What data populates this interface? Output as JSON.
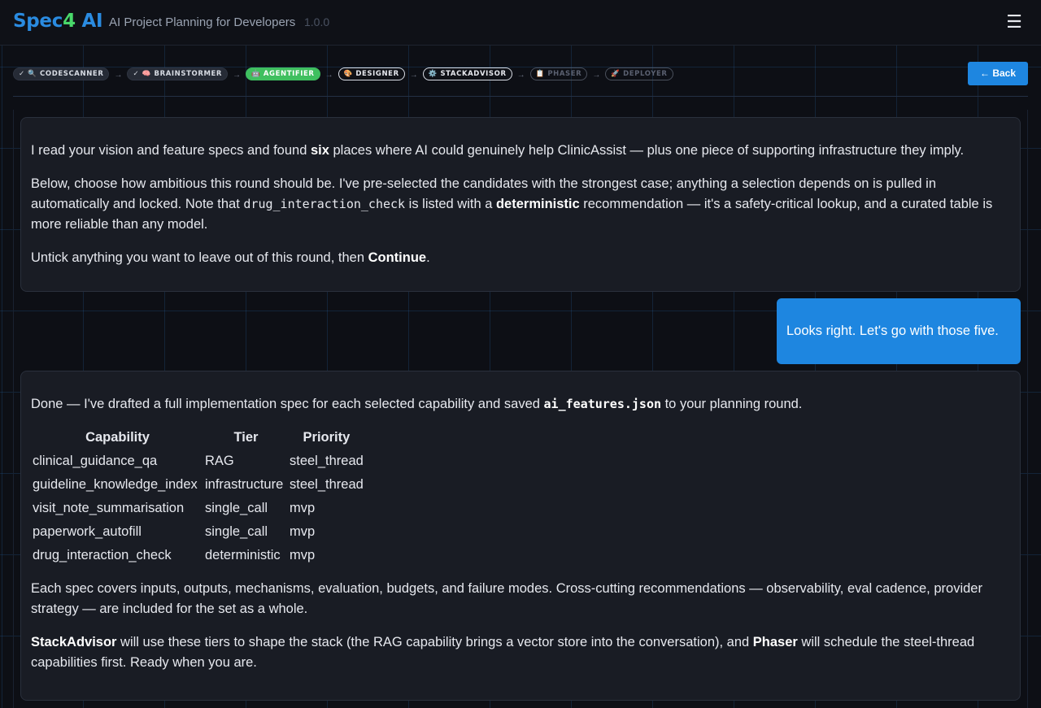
{
  "header": {
    "logo_prefix": "Spec",
    "logo_number": "4",
    "logo_suffix": " AI",
    "tagline": "AI Project Planning for Developers",
    "version": "1.0.0",
    "menu_icon": "☰"
  },
  "pipeline": {
    "steps": [
      {
        "label": "✓ 🔍 CODESCANNER",
        "state": "done"
      },
      {
        "label": "✓ 🧠 BRAINSTORMER",
        "state": "done"
      },
      {
        "label": "🤖 AGENTIFIER",
        "state": "active"
      },
      {
        "label": "🎨 DESIGNER",
        "state": "next"
      },
      {
        "label": "⚙️ STACKADVISOR",
        "state": "next"
      },
      {
        "label": "📋 PHASER",
        "state": "future"
      },
      {
        "label": "🚀 DEPLOYER",
        "state": "future"
      }
    ],
    "arrow": "→",
    "back_label": "← Back"
  },
  "messages": {
    "first": {
      "p1_a": "I read your vision and feature specs and found ",
      "p1_b": "six",
      "p1_c": " places where AI could genuinely help ClinicAssist — plus one piece of supporting infrastructure they imply.",
      "p2_a": "Below, choose how ambitious this round should be. I've pre-selected the candidates with the strongest case; anything a selection depends on is pulled in automatically and locked. Note that ",
      "p2_code": "drug_interaction_check",
      "p2_b": " is listed with a ",
      "p2_bold": "deterministic",
      "p2_c": " recommendation — it's a safety-critical lookup, and a curated table is more reliable than any model.",
      "p3_a": "Untick anything you want to leave out of this round, then ",
      "p3_bold": "Continue",
      "p3_c": "."
    },
    "user": "Looks right. Let's go with those five.",
    "second": {
      "p1_a": "Done — I've drafted a full implementation spec for each selected capability and saved ",
      "p1_code": "ai_features.json",
      "p1_b": " to your planning round.",
      "table": {
        "headers": [
          "Capability",
          "Tier",
          "Priority"
        ],
        "rows": [
          [
            "clinical_guidance_qa",
            "RAG",
            "steel_thread"
          ],
          [
            "guideline_knowledge_index",
            "infrastructure",
            "steel_thread"
          ],
          [
            "visit_note_summarisation",
            "single_call",
            "mvp"
          ],
          [
            "paperwork_autofill",
            "single_call",
            "mvp"
          ],
          [
            "drug_interaction_check",
            "deterministic",
            "mvp"
          ]
        ]
      },
      "p2": "Each spec covers inputs, outputs, mechanisms, evaluation, budgets, and failure modes. Cross-cutting recommendations — observability, eval cadence, provider strategy — are included for the set as a whole.",
      "p3_bold1": "StackAdvisor",
      "p3_a": " will use these tiers to shape the stack (the RAG capability brings a vector store into the conversation), and ",
      "p3_bold2": "Phaser",
      "p3_b": " will schedule the steel-thread capabilities first. Ready when you are."
    }
  }
}
